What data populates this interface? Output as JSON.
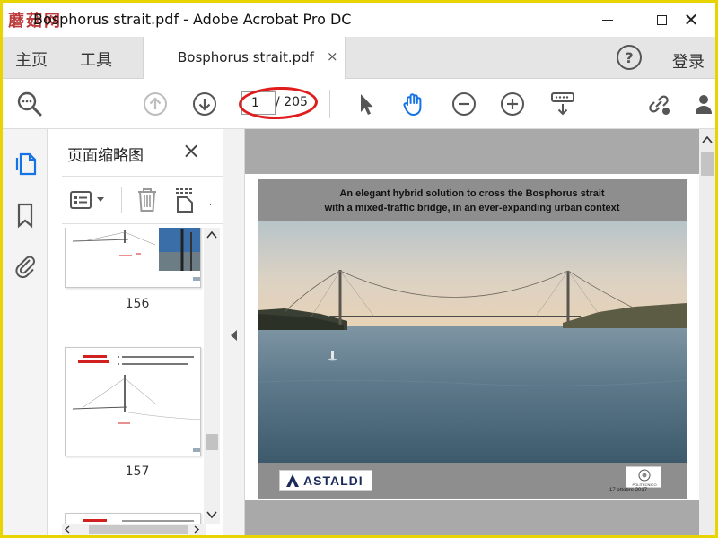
{
  "window": {
    "app_logo": "蘑菇网",
    "title": "Bosphorus strait.pdf - Adobe Acrobat Pro DC"
  },
  "tabs": {
    "home_label": "主页",
    "tools_label": "工具",
    "document_tab_label": "Bosphorus strait.pdf",
    "document_tab_close": "×",
    "help_label": "?",
    "login_label": "登录"
  },
  "toolbar": {
    "current_page": "1",
    "total_pages": "/ 205",
    "highlight_color": "#e01c1c",
    "accent_color": "#1473e6"
  },
  "thumbnails_panel": {
    "title": "页面缩略图",
    "close": "×",
    "items": [
      {
        "page_number": "156"
      },
      {
        "page_number": "157"
      }
    ]
  },
  "document": {
    "slide": {
      "title_line_1": "An elegant hybrid solution to cross the Bosphorus strait",
      "title_line_2": "with a mixed-traffic bridge, in an ever-expanding urban context",
      "logo_left_text": "ASTALDI",
      "logo_right_text": "POLITECNICO",
      "date": "17 ottobre 2017"
    }
  }
}
